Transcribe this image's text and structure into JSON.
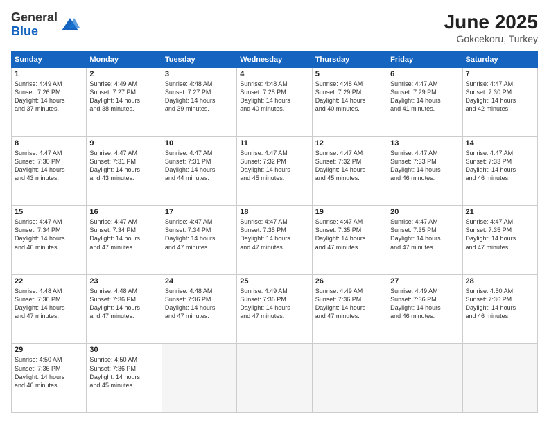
{
  "logo": {
    "general": "General",
    "blue": "Blue"
  },
  "title": "June 2025",
  "subtitle": "Gokcekoru, Turkey",
  "days_header": [
    "Sunday",
    "Monday",
    "Tuesday",
    "Wednesday",
    "Thursday",
    "Friday",
    "Saturday"
  ],
  "weeks": [
    [
      {
        "day": "1",
        "info": "Sunrise: 4:49 AM\nSunset: 7:26 PM\nDaylight: 14 hours\nand 37 minutes."
      },
      {
        "day": "2",
        "info": "Sunrise: 4:49 AM\nSunset: 7:27 PM\nDaylight: 14 hours\nand 38 minutes."
      },
      {
        "day": "3",
        "info": "Sunrise: 4:48 AM\nSunset: 7:27 PM\nDaylight: 14 hours\nand 39 minutes."
      },
      {
        "day": "4",
        "info": "Sunrise: 4:48 AM\nSunset: 7:28 PM\nDaylight: 14 hours\nand 40 minutes."
      },
      {
        "day": "5",
        "info": "Sunrise: 4:48 AM\nSunset: 7:29 PM\nDaylight: 14 hours\nand 40 minutes."
      },
      {
        "day": "6",
        "info": "Sunrise: 4:47 AM\nSunset: 7:29 PM\nDaylight: 14 hours\nand 41 minutes."
      },
      {
        "day": "7",
        "info": "Sunrise: 4:47 AM\nSunset: 7:30 PM\nDaylight: 14 hours\nand 42 minutes."
      }
    ],
    [
      {
        "day": "8",
        "info": "Sunrise: 4:47 AM\nSunset: 7:30 PM\nDaylight: 14 hours\nand 43 minutes."
      },
      {
        "day": "9",
        "info": "Sunrise: 4:47 AM\nSunset: 7:31 PM\nDaylight: 14 hours\nand 43 minutes."
      },
      {
        "day": "10",
        "info": "Sunrise: 4:47 AM\nSunset: 7:31 PM\nDaylight: 14 hours\nand 44 minutes."
      },
      {
        "day": "11",
        "info": "Sunrise: 4:47 AM\nSunset: 7:32 PM\nDaylight: 14 hours\nand 45 minutes."
      },
      {
        "day": "12",
        "info": "Sunrise: 4:47 AM\nSunset: 7:32 PM\nDaylight: 14 hours\nand 45 minutes."
      },
      {
        "day": "13",
        "info": "Sunrise: 4:47 AM\nSunset: 7:33 PM\nDaylight: 14 hours\nand 46 minutes."
      },
      {
        "day": "14",
        "info": "Sunrise: 4:47 AM\nSunset: 7:33 PM\nDaylight: 14 hours\nand 46 minutes."
      }
    ],
    [
      {
        "day": "15",
        "info": "Sunrise: 4:47 AM\nSunset: 7:34 PM\nDaylight: 14 hours\nand 46 minutes."
      },
      {
        "day": "16",
        "info": "Sunrise: 4:47 AM\nSunset: 7:34 PM\nDaylight: 14 hours\nand 47 minutes."
      },
      {
        "day": "17",
        "info": "Sunrise: 4:47 AM\nSunset: 7:34 PM\nDaylight: 14 hours\nand 47 minutes."
      },
      {
        "day": "18",
        "info": "Sunrise: 4:47 AM\nSunset: 7:35 PM\nDaylight: 14 hours\nand 47 minutes."
      },
      {
        "day": "19",
        "info": "Sunrise: 4:47 AM\nSunset: 7:35 PM\nDaylight: 14 hours\nand 47 minutes."
      },
      {
        "day": "20",
        "info": "Sunrise: 4:47 AM\nSunset: 7:35 PM\nDaylight: 14 hours\nand 47 minutes."
      },
      {
        "day": "21",
        "info": "Sunrise: 4:47 AM\nSunset: 7:35 PM\nDaylight: 14 hours\nand 47 minutes."
      }
    ],
    [
      {
        "day": "22",
        "info": "Sunrise: 4:48 AM\nSunset: 7:36 PM\nDaylight: 14 hours\nand 47 minutes."
      },
      {
        "day": "23",
        "info": "Sunrise: 4:48 AM\nSunset: 7:36 PM\nDaylight: 14 hours\nand 47 minutes."
      },
      {
        "day": "24",
        "info": "Sunrise: 4:48 AM\nSunset: 7:36 PM\nDaylight: 14 hours\nand 47 minutes."
      },
      {
        "day": "25",
        "info": "Sunrise: 4:49 AM\nSunset: 7:36 PM\nDaylight: 14 hours\nand 47 minutes."
      },
      {
        "day": "26",
        "info": "Sunrise: 4:49 AM\nSunset: 7:36 PM\nDaylight: 14 hours\nand 47 minutes."
      },
      {
        "day": "27",
        "info": "Sunrise: 4:49 AM\nSunset: 7:36 PM\nDaylight: 14 hours\nand 46 minutes."
      },
      {
        "day": "28",
        "info": "Sunrise: 4:50 AM\nSunset: 7:36 PM\nDaylight: 14 hours\nand 46 minutes."
      }
    ],
    [
      {
        "day": "29",
        "info": "Sunrise: 4:50 AM\nSunset: 7:36 PM\nDaylight: 14 hours\nand 46 minutes."
      },
      {
        "day": "30",
        "info": "Sunrise: 4:50 AM\nSunset: 7:36 PM\nDaylight: 14 hours\nand 45 minutes."
      },
      {
        "day": "",
        "info": ""
      },
      {
        "day": "",
        "info": ""
      },
      {
        "day": "",
        "info": ""
      },
      {
        "day": "",
        "info": ""
      },
      {
        "day": "",
        "info": ""
      }
    ]
  ]
}
